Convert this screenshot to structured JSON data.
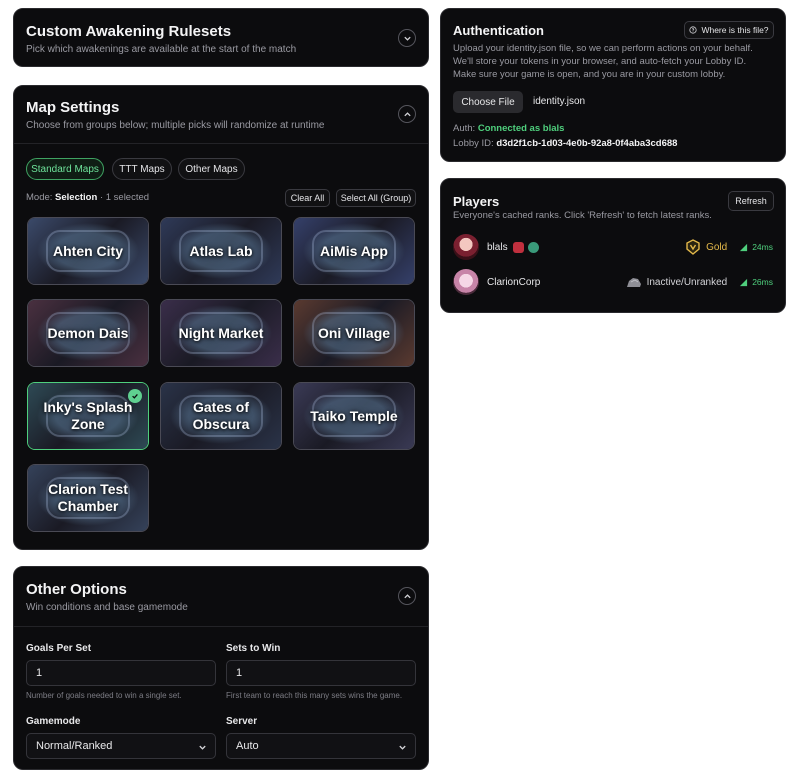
{
  "awakening": {
    "title": "Custom Awakening Rulesets",
    "subtitle": "Pick which awakenings are available at the start of the match"
  },
  "map_settings": {
    "title": "Map Settings",
    "subtitle": "Choose from groups below; multiple picks will randomize at runtime",
    "tabs": [
      "Standard Maps",
      "TTT Maps",
      "Other Maps"
    ],
    "active_tab": "Standard Maps",
    "mode_label": "Mode:",
    "mode_value": "Selection",
    "selected_count": "· 1 selected",
    "clear_all": "Clear All",
    "select_all": "Select All (Group)",
    "maps": [
      {
        "name": "Ahten City",
        "selected": false,
        "color": "#3b4a6a"
      },
      {
        "name": "Atlas Lab",
        "selected": false,
        "color": "#2f3a58"
      },
      {
        "name": "AiMis App",
        "selected": false,
        "color": "#35406a"
      },
      {
        "name": "Demon Dais",
        "selected": false,
        "color": "#4a3040"
      },
      {
        "name": "Night Market",
        "selected": false,
        "color": "#3a2e4a"
      },
      {
        "name": "Oni Village",
        "selected": false,
        "color": "#5a3a30"
      },
      {
        "name": "Inky's Splash Zone",
        "selected": true,
        "color": "#2e4a55"
      },
      {
        "name": "Gates of Obscura",
        "selected": false,
        "color": "#2a3348"
      },
      {
        "name": "Taiko Temple",
        "selected": false,
        "color": "#3a3a55"
      },
      {
        "name": "Clarion Test Chamber",
        "selected": false,
        "color": "#35425a"
      }
    ]
  },
  "other_options": {
    "title": "Other Options",
    "subtitle": "Win conditions and base gamemode",
    "goals_label": "Goals Per Set",
    "goals_value": "1",
    "goals_help": "Number of goals needed to win a single set.",
    "sets_label": "Sets to Win",
    "sets_value": "1",
    "sets_help": "First team to reach this many sets wins the game.",
    "gamemode_label": "Gamemode",
    "gamemode_value": "Normal/Ranked",
    "server_label": "Server",
    "server_value": "Auto"
  },
  "auth": {
    "title": "Authentication",
    "help_button": "Where is this file?",
    "desc_line1": "Upload your identity.json file, so we can perform actions on your behalf.",
    "desc_line2": "We'll store your tokens in your browser, and auto-fetch your Lobby ID.",
    "desc_line3": "Make sure your game is open, and you are in your custom lobby.",
    "choose_file": "Choose File",
    "file_name": "identity.json",
    "auth_label": "Auth:",
    "auth_status": "Connected as blals",
    "lobby_label": "Lobby ID:",
    "lobby_id": "d3d2f1cb-1d03-4e0b-92a8-0f4aba3cd688",
    "status_color": "#4fcf7d"
  },
  "players": {
    "title": "Players",
    "subtitle": "Everyone's cached ranks. Click 'Refresh' to fetch latest ranks.",
    "refresh": "Refresh",
    "list": [
      {
        "name": "blals",
        "rank": "Gold",
        "ping": "24ms"
      },
      {
        "name": "ClarionCorp",
        "rank": "Inactive/Unranked",
        "ping": "26ms"
      }
    ]
  }
}
